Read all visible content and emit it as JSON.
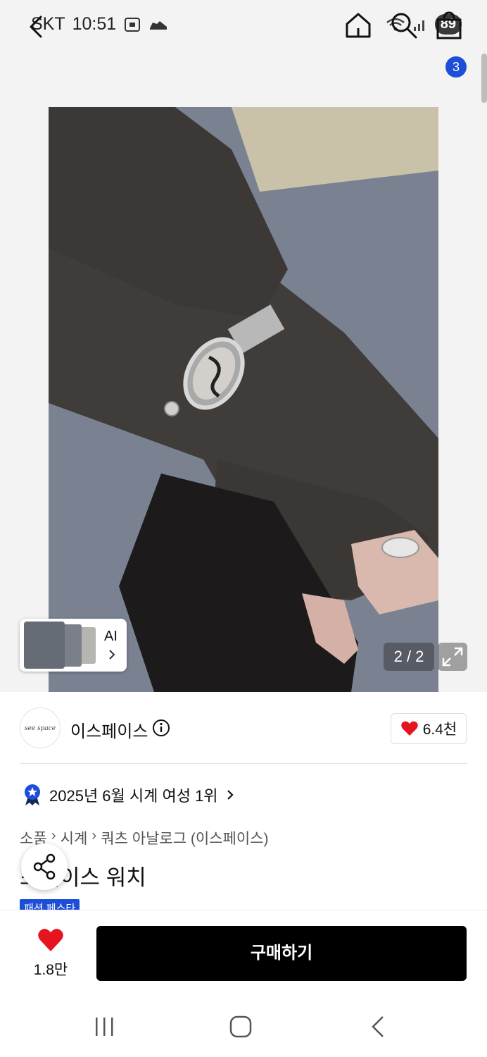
{
  "status": {
    "carrier": "SKT",
    "time": "10:51",
    "battery": "89"
  },
  "nav": {
    "cart_count": "3"
  },
  "gallery": {
    "ai_label": "AI",
    "pager": "2 / 2"
  },
  "brand": {
    "logo_text": "see space",
    "name": "이스페이스",
    "likes": "6.4천"
  },
  "ranking": {
    "text": "2025년 6월 시계 여성 1위"
  },
  "breadcrumb": [
    "소품",
    "시계",
    "쿼츠 아날로그 (이스페이스)"
  ],
  "product": {
    "title": "스페이스 워치",
    "promo_tag": "패션 페스타"
  },
  "actions": {
    "wish_count": "1.8만",
    "buy_label": "구매하기"
  },
  "colors": {
    "accent": "#1d4ed8",
    "heart": "#e5141e",
    "buy_button": "#000000"
  }
}
